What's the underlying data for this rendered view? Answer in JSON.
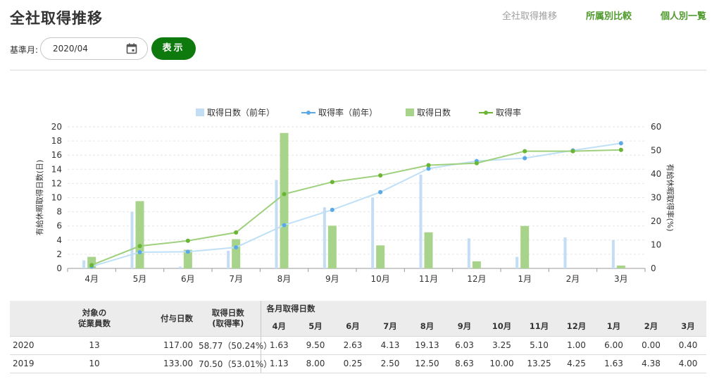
{
  "page": {
    "title": "全社取得推移",
    "nav": [
      "全社取得推移",
      "所属別比較",
      "個人別一覧"
    ]
  },
  "filter": {
    "label": "基準月:",
    "date_value": "2020/04",
    "show_button": "表示"
  },
  "colors": {
    "accent": "#0e7a0e",
    "nav_active": "#4f9a2c",
    "bar_prev": "#c3ddf4",
    "line_prev": "#5aa9e6",
    "bar_curr": "#a8d38a",
    "line_curr": "#6ab533"
  },
  "chart_data": {
    "type": "bar",
    "categories": [
      "4月",
      "5月",
      "6月",
      "7月",
      "8月",
      "9月",
      "10月",
      "11月",
      "12月",
      "1月",
      "2月",
      "3月"
    ],
    "y_left": {
      "label": "有給休暇取得日数(日)",
      "ticks": [
        "0",
        "2",
        "4",
        "6",
        "8",
        "10",
        "12",
        "14",
        "16",
        "18",
        "20"
      ],
      "range": [
        0,
        20
      ]
    },
    "y_right": {
      "label": "有給休暇取得率(%)",
      "ticks": [
        "0",
        "10",
        "20",
        "30",
        "40",
        "50",
        "60"
      ],
      "range": [
        0,
        60
      ]
    },
    "legend_position": "top",
    "series": [
      {
        "name": "取得日数（前年）",
        "kind": "bar",
        "axis": "left",
        "values": [
          1.13,
          8.0,
          0.25,
          2.5,
          12.5,
          8.63,
          10.0,
          13.25,
          4.25,
          1.63,
          4.38,
          4.0
        ]
      },
      {
        "name": "取得率（前年）",
        "kind": "line",
        "axis": "right",
        "values": [
          0.85,
          6.86,
          7.05,
          8.93,
          18.33,
          24.82,
          32.33,
          42.29,
          45.49,
          46.71,
          50.0,
          53.01
        ]
      },
      {
        "name": "取得日数",
        "kind": "bar",
        "axis": "left",
        "values": [
          1.63,
          9.5,
          2.63,
          4.13,
          19.13,
          6.03,
          3.25,
          5.1,
          1.0,
          6.0,
          0.0,
          0.4
        ]
      },
      {
        "name": "取得率",
        "kind": "line",
        "axis": "right",
        "values": [
          1.39,
          9.47,
          11.71,
          15.22,
          31.49,
          36.62,
          39.39,
          43.73,
          44.58,
          49.68,
          49.68,
          50.24
        ]
      }
    ]
  },
  "table": {
    "headers": {
      "employees": "対象の\n従業員数",
      "granted": "付与日数",
      "acquired": "取得日数\n(取得率)",
      "monthly": "各月取得日数",
      "months": [
        "4月",
        "5月",
        "6月",
        "7月",
        "8月",
        "9月",
        "10月",
        "11月",
        "12月",
        "1月",
        "2月",
        "3月"
      ]
    },
    "rows": [
      {
        "year": "2020",
        "employees": "13",
        "granted": "117.00",
        "acquired": "58.77（50.24%）",
        "months": [
          "1.63",
          "9.50",
          "2.63",
          "4.13",
          "19.13",
          "6.03",
          "3.25",
          "5.10",
          "1.00",
          "6.00",
          "0.00",
          "0.40"
        ]
      },
      {
        "year": "2019",
        "employees": "10",
        "granted": "133.00",
        "acquired": "70.50（53.01%）",
        "months": [
          "1.13",
          "8.00",
          "0.25",
          "2.50",
          "12.50",
          "8.63",
          "10.00",
          "13.25",
          "4.25",
          "1.63",
          "4.38",
          "4.00"
        ]
      }
    ]
  }
}
